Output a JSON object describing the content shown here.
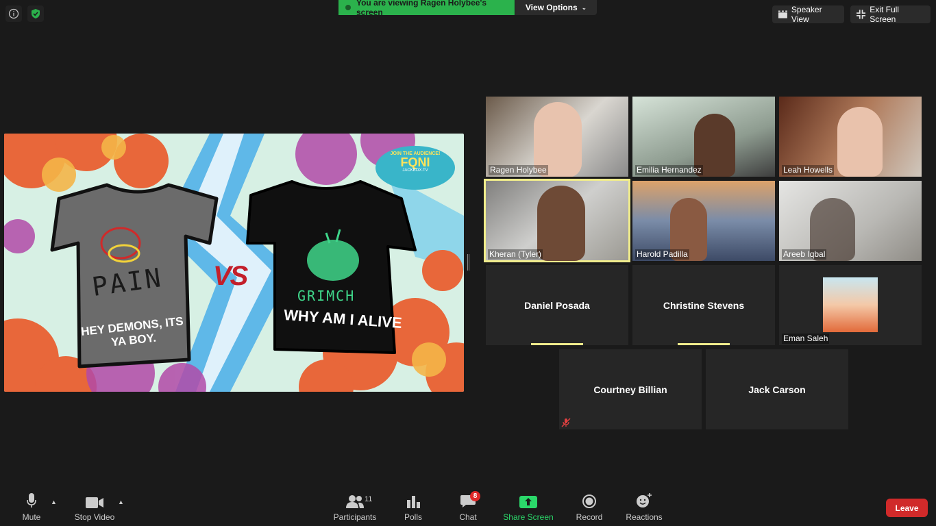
{
  "banner": {
    "viewing_text": "You are viewing Ragen Holybee's screen",
    "view_options_label": "View Options"
  },
  "top_right": {
    "speaker_view_label": "Speaker View",
    "exit_fullscreen_label": "Exit Full Screen"
  },
  "shared_content": {
    "shirt_left": {
      "top_text": "PAIN",
      "bottom_text": "HEY DEMONS, ITS YA BOY."
    },
    "vs_text": "VS",
    "shirt_right": {
      "top_text": "GRIMCH",
      "bottom_text": "WHY AM I ALIVE"
    },
    "logo": {
      "line1": "JOIN THE AUDIENCE!",
      "line2": "FQNI",
      "line3": "JACKBOX.TV"
    }
  },
  "participants": [
    {
      "name": "Ragen Holybee",
      "video": true
    },
    {
      "name": "Emilia Hernandez",
      "video": true
    },
    {
      "name": "Leah Howells",
      "video": true
    },
    {
      "name": "Kheran (Tyler)",
      "video": true,
      "active_speaker": true
    },
    {
      "name": "Harold Padilla",
      "video": true
    },
    {
      "name": "Areeb Iqbal",
      "video": true
    },
    {
      "name": "Daniel Posada",
      "video": false
    },
    {
      "name": "Christine Stevens",
      "video": false
    },
    {
      "name": "Eman Saleh",
      "video": false,
      "avatar": true
    },
    {
      "name": "Courtney Billian",
      "video": false,
      "muted": true
    },
    {
      "name": "Jack Carson",
      "video": false
    }
  ],
  "toolbar": {
    "mute_label": "Mute",
    "stop_video_label": "Stop Video",
    "participants_label": "Participants",
    "participants_count": "11",
    "polls_label": "Polls",
    "chat_label": "Chat",
    "chat_badge": "8",
    "share_screen_label": "Share Screen",
    "record_label": "Record",
    "reactions_label": "Reactions",
    "leave_label": "Leave"
  },
  "colors": {
    "accent_green": "#2bb24c",
    "active_speaker": "#f0ec8c",
    "leave_red": "#d02a2a"
  }
}
